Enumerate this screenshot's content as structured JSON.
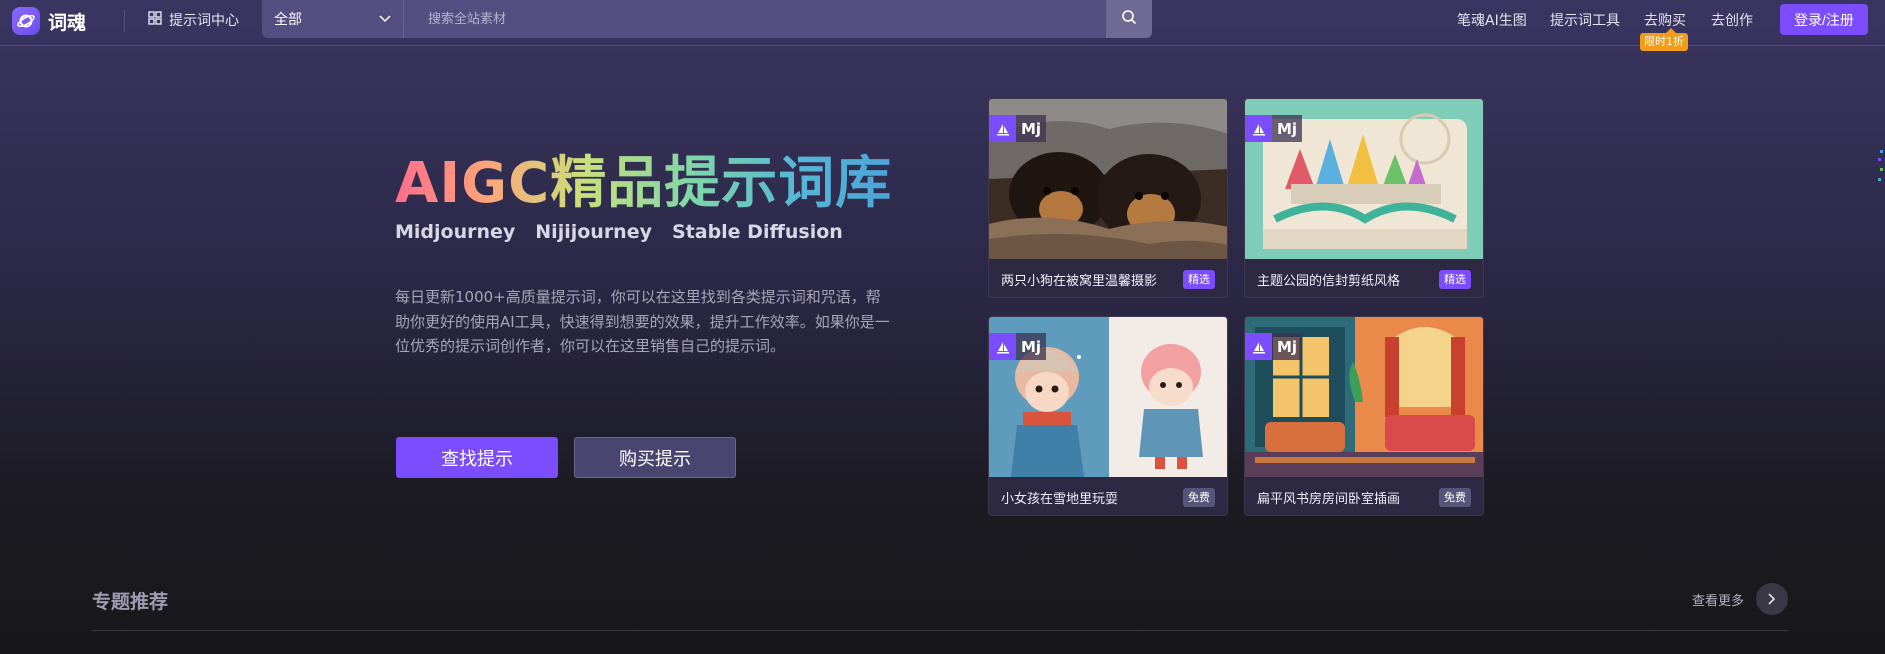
{
  "nav": {
    "logo_text": "词魂",
    "prompt_center_label": "提示词中心",
    "search": {
      "category": "全部",
      "placeholder": "搜索全站素材"
    },
    "links": [
      "笔魂AI生图",
      "提示词工具",
      "去购买",
      "去创作"
    ],
    "sale_badge": "限时1折",
    "login_label": "登录/注册"
  },
  "hero": {
    "title": "AIGC精品提示词库",
    "models": [
      "Midjourney",
      "Nijijourney",
      "Stable Diffusion"
    ],
    "description": "每日更新1000+高质量提示词，你可以在这里找到各类提示词和咒语，帮助你更好的使用AI工具，快速得到想要的效果，提升工作效率。如果你是一位优秀的提示词创作者，你可以在这里销售自己的提示词。",
    "primary_button": "查找提示",
    "secondary_button": "购买提示"
  },
  "cards": [
    {
      "tag": "Mj",
      "title": "两只小狗在被窝里温馨摄影",
      "badge": "精选",
      "badge_type": "featured"
    },
    {
      "tag": "Mj",
      "title": "主题公园的信封剪纸风格",
      "badge": "精选",
      "badge_type": "featured"
    },
    {
      "tag": "Mj",
      "title": "小女孩在雪地里玩耍",
      "badge": "免费",
      "badge_type": "free"
    },
    {
      "tag": "Mj",
      "title": "扁平风书房房间卧室插画",
      "badge": "免费",
      "badge_type": "free"
    }
  ],
  "section": {
    "title": "专题推荐",
    "more_label": "查看更多"
  },
  "colors": {
    "accent": "#7b4dff",
    "sale_badge": "#f39a1b",
    "free_badge": "#58557a"
  }
}
